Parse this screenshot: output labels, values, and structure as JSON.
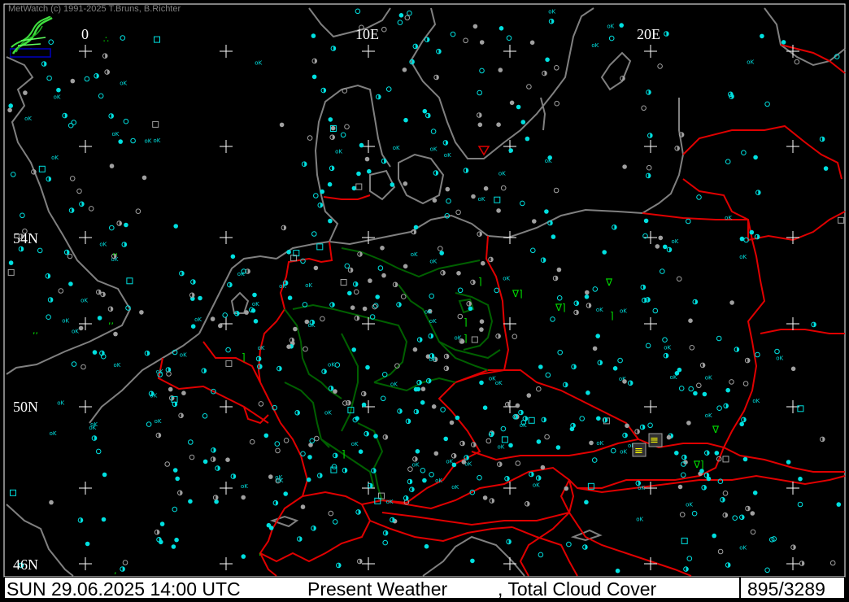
{
  "app": {
    "credit": "MetWatch  (c) 1991-2025 T.Bruns, B.Richter"
  },
  "map": {
    "longitude_labels": [
      "0",
      "10E",
      "20E"
    ],
    "latitude_labels": [
      "54N",
      "50N",
      "46N"
    ],
    "station_ok_label": "oK",
    "colors": {
      "background": "#000000",
      "coastline": "#808080",
      "country_border": "#e00000",
      "state_border": "#006000",
      "grid_cross": "#ffffff",
      "station_cyan": "#00e0e0",
      "station_gray": "#a0a0a0",
      "weather_green": "#00e000",
      "weather_yellow": "#ffff00"
    }
  },
  "status_bar": {
    "datetime": "SUN 29.06.2025 14:00 UTC",
    "parameter": "Present Weather",
    "secondary": ", Total Cloud Cover",
    "count": "895/3289"
  }
}
